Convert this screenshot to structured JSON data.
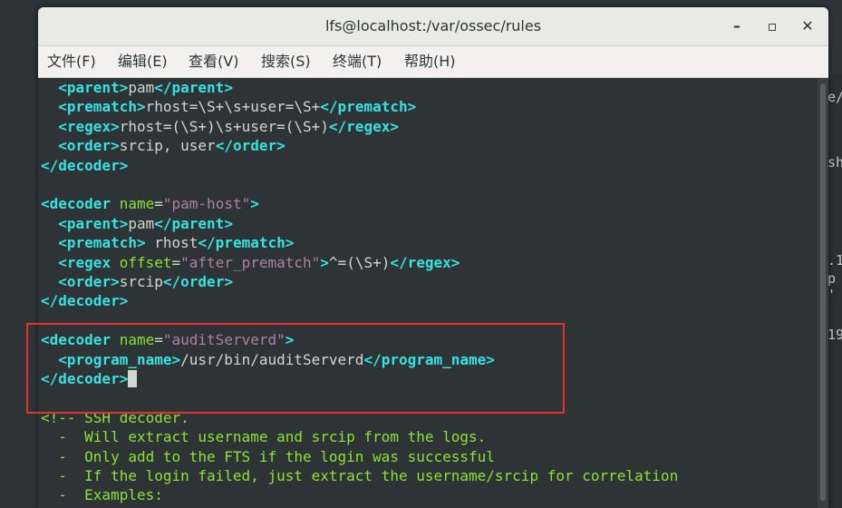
{
  "window": {
    "title": "lfs@localhost:/var/ossec/rules",
    "minimize_glyph": "–",
    "maximize_glyph": "▫",
    "close_glyph": "✕"
  },
  "menu": [
    {
      "label": "文件(F)"
    },
    {
      "label": "编辑(E)"
    },
    {
      "label": "查看(V)"
    },
    {
      "label": "搜索(S)"
    },
    {
      "label": "终端(T)"
    },
    {
      "label": "帮助(H)"
    }
  ],
  "terminal": {
    "lines": [
      {
        "indent": "  ",
        "open": "parent",
        "text": "pam",
        "close": "parent"
      },
      {
        "indent": "  ",
        "open": "prematch",
        "text": "rhost=\\S+\\s+user=\\S+",
        "close": "prematch"
      },
      {
        "indent": "  ",
        "open": "regex",
        "text": "rhost=(\\S+)\\s+user=(\\S+)",
        "close": "regex"
      },
      {
        "indent": "  ",
        "open": "order",
        "text": "srcip, user",
        "close": "order"
      },
      {
        "indent": "",
        "close_only": "decoder"
      },
      {
        "blank": true
      },
      {
        "indent": "",
        "open": "decoder",
        "attr": "name",
        "value": "\"pam-host\""
      },
      {
        "indent": "  ",
        "open": "parent",
        "text": "pam",
        "close": "parent"
      },
      {
        "indent": "  ",
        "open": "prematch",
        "text": " rhost",
        "close": "prematch"
      },
      {
        "indent": "  ",
        "open": "regex",
        "attr": "offset",
        "value": "\"after_prematch\"",
        "text": "^=(\\S+)",
        "close": "regex"
      },
      {
        "indent": "  ",
        "open": "order",
        "text": "srcip",
        "close": "order"
      },
      {
        "indent": "",
        "close_only": "decoder"
      },
      {
        "blank": true
      },
      {
        "indent": "",
        "open": "decoder",
        "attr": "name",
        "value": "\"auditServerd\""
      },
      {
        "indent": "  ",
        "open": "program_name",
        "text": "/usr/bin/auditServerd",
        "close": "program_name"
      },
      {
        "indent": "",
        "close_only": "decoder",
        "cursor": true
      },
      {
        "blank": true
      },
      {
        "comment": "<!-- SSH decoder."
      },
      {
        "comment": "  -  Will extract username and srcip from the logs."
      },
      {
        "comment": "  -  Only add to the FTS if the login was successful"
      },
      {
        "comment": "  -  If the login failed, just extract the username/srcip for correlation"
      },
      {
        "comment": "  -  Examples:"
      }
    ]
  },
  "background_window": {
    "fragments": [
      "e/",
      "sh",
      ".1",
      " p",
      "'",
      "19"
    ]
  },
  "colors": {
    "tag": "#34e2e2",
    "attr": "#8ae234",
    "string": "#ad7fa8",
    "text": "#d3d7cf",
    "terminal_bg": "#2e3436",
    "highlight": "#e53030"
  }
}
